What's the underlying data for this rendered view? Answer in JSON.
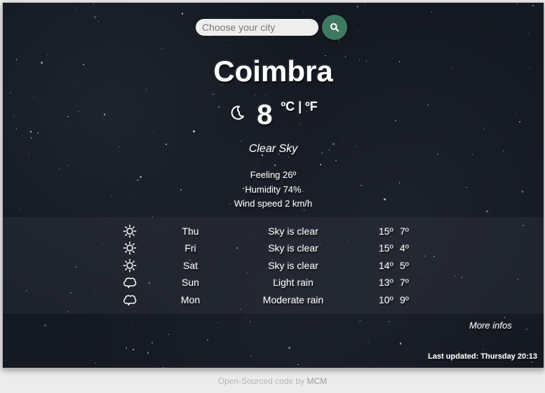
{
  "search": {
    "placeholder": "Choose your city",
    "value": "",
    "button_icon": "search-icon"
  },
  "current": {
    "city": "Coimbra",
    "icon": "moon-icon",
    "temperature": "8",
    "unit_celsius": "ºC",
    "unit_separator": "|",
    "unit_fahrenheit": "ºF",
    "description": "Clear Sky",
    "feeling": "Feeling 26º",
    "humidity": "Humidity 74%",
    "wind": "Wind speed 2 km/h"
  },
  "forecast": [
    {
      "icon": "sun-icon",
      "day": "Thu",
      "description": "Sky is clear",
      "max": "15º",
      "min": "7º"
    },
    {
      "icon": "sun-icon",
      "day": "Fri",
      "description": "Sky is clear",
      "max": "15º",
      "min": "4º"
    },
    {
      "icon": "sun-icon",
      "day": "Sat",
      "description": "Sky is clear",
      "max": "14º",
      "min": "5º"
    },
    {
      "icon": "rain-cloud-icon",
      "day": "Sun",
      "description": "Light rain",
      "max": "13º",
      "min": "7º"
    },
    {
      "icon": "rain-cloud-icon",
      "day": "Mon",
      "description": "Moderate rain",
      "max": "10º",
      "min": "9º"
    }
  ],
  "more_infos": "More infos",
  "last_updated": "Last updated: Thursday 20:13",
  "footer": {
    "text": "Open-Sourced code by ",
    "author": "MCM"
  },
  "colors": {
    "accent": "#3f7a60",
    "background": "#141820",
    "page": "#ececec"
  }
}
